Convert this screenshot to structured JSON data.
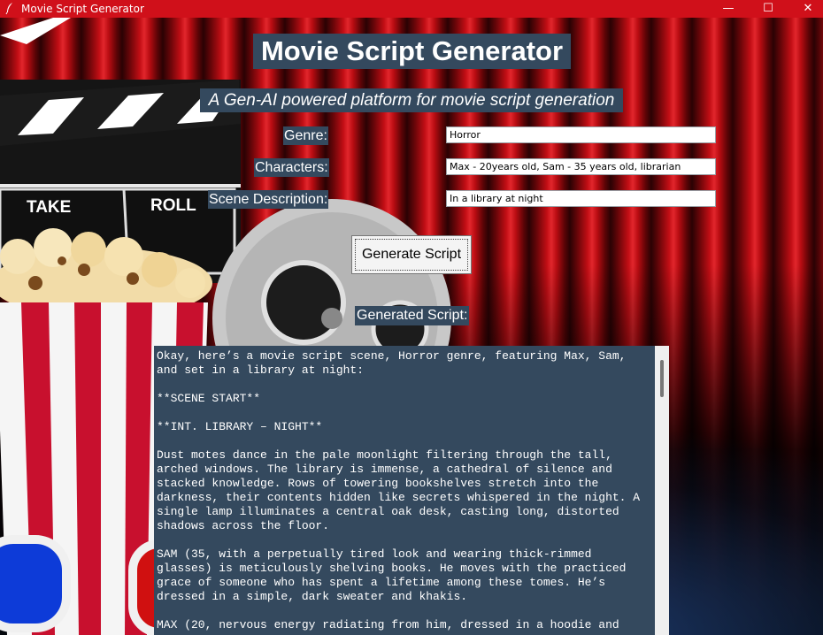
{
  "window": {
    "title": "Movie Script Generator",
    "minimize": "—",
    "maximize": "☐",
    "close": "✕"
  },
  "header": {
    "title": "Movie Script Generator",
    "subtitle": "A Gen-AI powered platform for movie script generation"
  },
  "backdrop": {
    "clapper_take": "TAKE",
    "clapper_roll": "ROLL"
  },
  "form": {
    "genre_label": "Genre:",
    "genre_value": "Horror",
    "characters_label": "Characters:",
    "characters_value": "Max - 20years old, Sam - 35 years old, librarian",
    "scene_label": "Scene Description:",
    "scene_value": "In a library at night",
    "generate_button": "Generate Script"
  },
  "output": {
    "label": "Generated Script:",
    "paragraphs": [
      "Okay, here’s a movie script scene, Horror genre, featuring Max, Sam,\nand set in a library at night:",
      "**SCENE START**",
      "**INT. LIBRARY – NIGHT**",
      "Dust motes dance in the pale moonlight filtering through the tall,\narched windows. The library is immense, a cathedral of silence and\nstacked knowledge. Rows of towering bookshelves stretch into the\ndarkness, their contents hidden like secrets whispered in the night. A\nsingle lamp illuminates a central oak desk, casting long, distorted\nshadows across the floor.",
      "SAM (35, with a perpetually tired look and wearing thick-rimmed\nglasses) is meticulously shelving books. He moves with the practiced\ngrace of someone who has spent a lifetime among these tomes. He’s\ndressed in a simple, dark sweater and khakis.",
      "MAX (20, nervous energy radiating from him, dressed in a hoodie and"
    ]
  },
  "colors": {
    "titlebar": "#d0101a",
    "label_bg": "#34495e",
    "curtain": "#c20e15"
  }
}
